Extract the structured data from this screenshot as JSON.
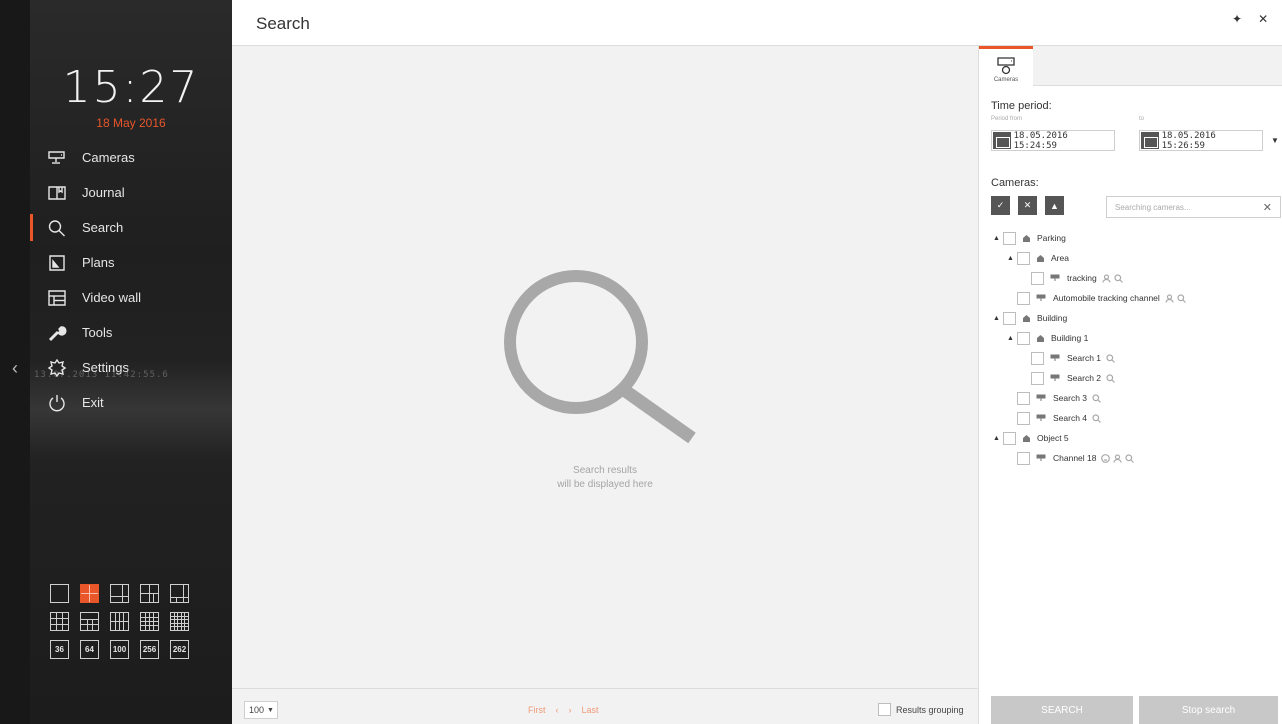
{
  "sidebar": {
    "time": "15:27",
    "date": "18 May 2016",
    "overlay_text": "13.07.2013  11:42:55.6",
    "items": [
      {
        "label": "Cameras",
        "icon": "camera-icon"
      },
      {
        "label": "Journal",
        "icon": "journal-icon"
      },
      {
        "label": "Search",
        "icon": "search-icon",
        "active": true
      },
      {
        "label": "Plans",
        "icon": "plans-icon"
      },
      {
        "label": "Video wall",
        "icon": "video-wall-icon"
      },
      {
        "label": "Tools",
        "icon": "wrench-icon"
      },
      {
        "label": "Settings",
        "icon": "gear-icon"
      },
      {
        "label": "Exit",
        "icon": "power-icon"
      }
    ],
    "layout_numbers": [
      "36",
      "64",
      "100",
      "256",
      "262"
    ],
    "accent_color": "#e8562a"
  },
  "main": {
    "title": "Search",
    "placeholder_line1": "Search results",
    "placeholder_line2": "will be displayed here",
    "page_size": "100",
    "pager_first": "First",
    "pager_last": "Last",
    "grouping_label": "Results grouping"
  },
  "right": {
    "tab_label": "Cameras",
    "time_period_label": "Time period:",
    "period_from_label": "Period from",
    "to_label": "to",
    "from_value": "18.05.2016  15:24:59",
    "to_value": "18.05.2016  15:26:59",
    "cameras_label": "Cameras:",
    "search_placeholder": "Searching cameras...",
    "tree": {
      "parking": "Parking",
      "area": "Area",
      "tracking": "tracking",
      "automobile": "Automobile tracking channel",
      "building": "Building",
      "building1": "Building 1",
      "search1": "Search 1",
      "search2": "Search 2",
      "search3": "Search 3",
      "search4": "Search 4",
      "object5": "Object 5",
      "channel18": "Channel 18"
    },
    "search_button": "SEARCH",
    "stop_button": "Stop search"
  }
}
